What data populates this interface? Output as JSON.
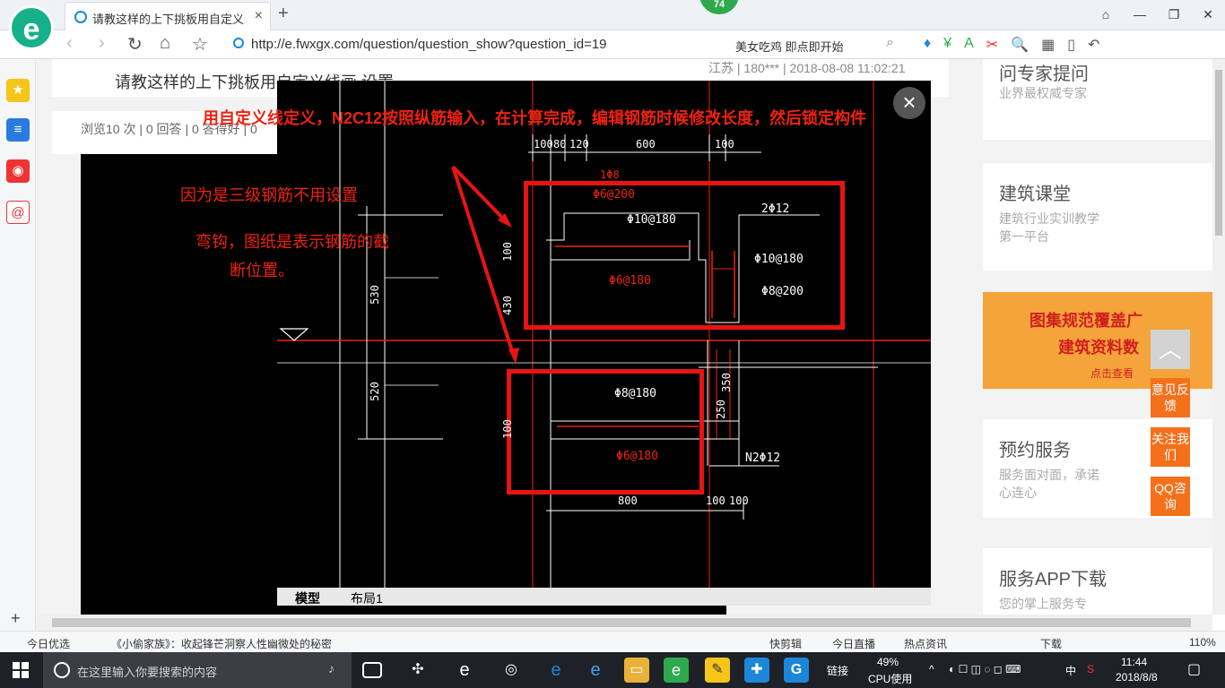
{
  "browser": {
    "logo_letter": "e",
    "tab_title": "请教这样的上下挑板用自定义线画",
    "tab_close": "×",
    "new_tab": "+",
    "badge_count": "74",
    "url": "http://e.fwxgx.com/question/question_show?question_id=19",
    "hot_search": "美女吃鸡 即点即开始",
    "window_controls": [
      "⌂",
      "—",
      "❐",
      "✕"
    ],
    "nav": {
      "back": "‹",
      "forward": "›",
      "reload": "↻",
      "home": "⌂",
      "star": "☆"
    },
    "toolbar_icons": [
      "♦",
      "¥",
      "A",
      "✂",
      "🔍",
      "▦",
      "▯",
      "↶"
    ]
  },
  "sidebar": {
    "items": [
      "★",
      "≡",
      "◉",
      "@"
    ],
    "add": "+"
  },
  "page": {
    "question_title": "请教这样的上下挑板用自定义线画 设置",
    "question_meta": "江苏 | 180*** | 2018-08-08 11:02:21",
    "stats": "浏览10 次 | 0 回答 | 0 答得好 | 0",
    "cards": [
      {
        "title": "问专家提问",
        "sub": "业界最权威专家"
      },
      {
        "title": "建筑课堂",
        "sub": "建筑行业实训教学第一平台"
      },
      {
        "title": "预约服务",
        "sub": "服务面对面，承诺心连心"
      },
      {
        "title": "服务APP下载",
        "sub": "您的掌上服务专"
      }
    ],
    "promo": {
      "line1": "图集规范覆盖广",
      "line2": "建筑资料数",
      "line3": "点击查看"
    },
    "float_buttons": [
      "意见反馈",
      "关注我们",
      "QQ咨询"
    ],
    "to_top": "︿"
  },
  "modal": {
    "close": "×",
    "annotation_top": "用自定义线定义，N2C12按照纵筋输入，在计算完成，编辑钢筋时候修改长度，然后锁定构件",
    "annotation_left_1": "因为是三级钢筋不用设置",
    "annotation_left_2": "弯钩，图纸是表示钢筋的截",
    "annotation_left_3": "断位置。",
    "cad_labels": {
      "d100a": "100",
      "d80": "80",
      "d120": "120",
      "d600": "600",
      "r1": "1Φ8",
      "r2": "Φ6@200",
      "r3": "Φ10@180",
      "r4": "2Φ12",
      "r5": "Φ10@180",
      "r6": "Φ6@180",
      "r7": "Φ8@200",
      "r8": "Φ8@180",
      "r9": "Φ6@180",
      "r10": "N2Φ12",
      "v350": "350",
      "v250": "250",
      "v100a": "100",
      "v430": "430",
      "v100b": "100",
      "v530": "530",
      "v520": "520",
      "b800": "800",
      "b100a": "100",
      "b100b": "100"
    },
    "tabs": [
      "模型",
      "布局1"
    ]
  },
  "statusbar": {
    "left": "今日优选",
    "news": "《小偷家族》：收起锋芒洞察人性幽微处的秘密",
    "items": [
      "快剪辑",
      "今日直播",
      "热点资讯",
      "下载"
    ],
    "zoom": "110%"
  },
  "taskbar": {
    "search_placeholder": "在这里输入你要搜索的内容",
    "tray_link": "链接",
    "cpu_pct": "49%",
    "cpu_label": "CPU使用",
    "ime": "中",
    "time": "11:44",
    "date": "2018/8/8"
  }
}
